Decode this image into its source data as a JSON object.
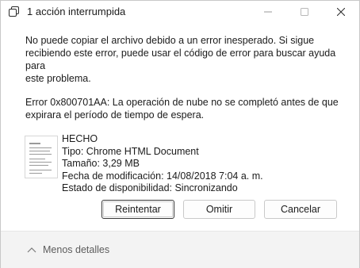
{
  "window": {
    "title": "1 acción interrumpida",
    "icon": "copy-icon",
    "controls": [
      "minimize-icon",
      "maximize-icon",
      "close-icon"
    ]
  },
  "message": {
    "line1": "No puede copiar el archivo debido a un error inesperado. Si sigue",
    "line2": "recibiendo este error, puede usar el código de error para buscar ayuda para",
    "line3": "este problema.",
    "error_line1": "Error 0x800701AA: La operación de nube no se completó antes de que",
    "error_line2": "expirara el período de tiempo de espera."
  },
  "file": {
    "name": "HECHO",
    "type": "Tipo: Chrome HTML Document",
    "size": "Tamaño: 3,29 MB",
    "modified": "Fecha de modificación: 14/08/2018 7:04 a. m.",
    "availability": "Estado de disponibilidad: Sincronizando"
  },
  "buttons": {
    "retry": "Reintentar",
    "omit": "Omitir",
    "cancel": "Cancelar"
  },
  "footer": {
    "less_details": "Menos detalles"
  }
}
